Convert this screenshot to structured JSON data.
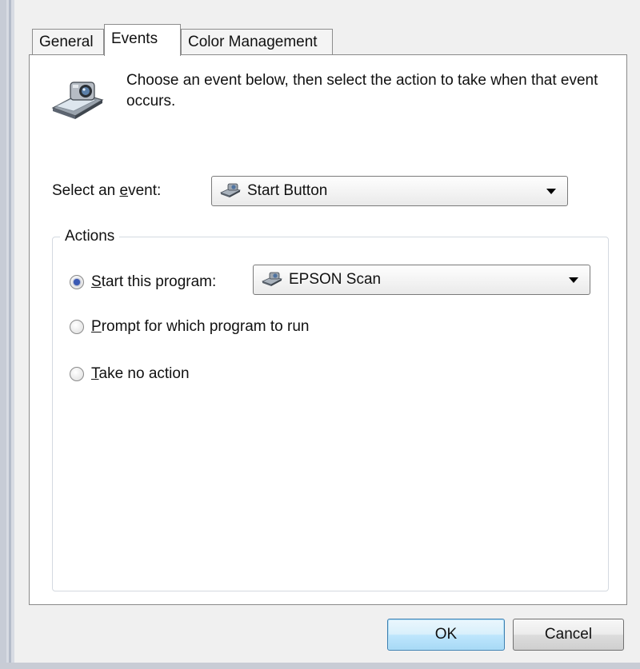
{
  "tabs": [
    {
      "label": "General"
    },
    {
      "label": "Events"
    },
    {
      "label": "Color Management"
    }
  ],
  "intro_text": "Choose an event below, then select the action to take when that event occurs.",
  "event_select": {
    "label_pre": "Select an ",
    "label_accel": "e",
    "label_post": "vent:",
    "value": "Start Button"
  },
  "actions": {
    "legend": "Actions",
    "options": [
      {
        "accel": "S",
        "rest": "tart this program:",
        "selected": true
      },
      {
        "accel": "P",
        "rest": "rompt for which program to run",
        "selected": false
      },
      {
        "accel": "T",
        "rest": "ake no action",
        "selected": false
      }
    ],
    "program_value": "EPSON Scan"
  },
  "buttons": {
    "ok": "OK",
    "cancel": "Cancel"
  },
  "icons": {
    "dialog": "scanner-camera-icon",
    "combo": "scanner-small-icon",
    "dropdown": "chevron-down-icon"
  },
  "colors": {
    "panel_bg": "#ffffff",
    "dialog_bg": "#f0f0f0",
    "radio_selected": "#3a59b4",
    "default_button": "#bee6fd"
  }
}
